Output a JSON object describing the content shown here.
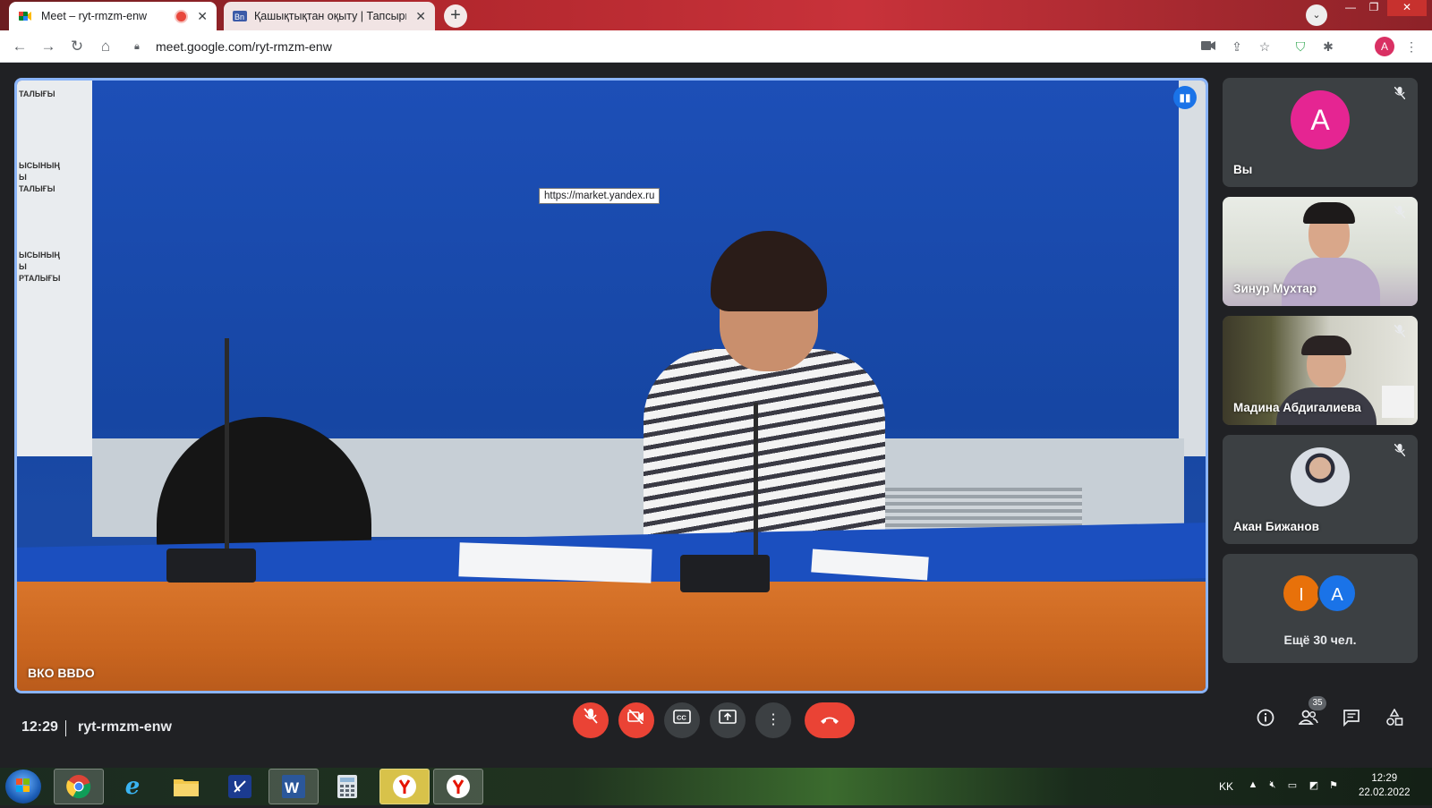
{
  "browser": {
    "tabs": [
      {
        "title": "Meet – ryt-rmzm-enw",
        "active": true,
        "recording": true,
        "favicon": "meet-favicon"
      },
      {
        "title": "Қашықтықтан оқыту | Тапсырма",
        "active": false,
        "favicon": "site-favicon"
      }
    ],
    "new_tab_label": "+",
    "url": "meet.google.com/ryt-rmzm-enw",
    "profile_initial": "A"
  },
  "meet": {
    "main_participant_name": "ВКО ВВDО",
    "hover_url": "https://market.yandex.ru",
    "banner_text": [
      "ТАЛЫҒЫ",
      "ЫСЫНЫҢ",
      "Ы",
      "ТАЛЫҒЫ",
      "ЫСЫНЫҢ",
      "Ы",
      "РТАЛЫҒЫ"
    ],
    "side_tiles": [
      {
        "name": "Вы",
        "avatar_initial": "A",
        "avatar_color": "#e52592",
        "muted": true
      },
      {
        "name": "Зинур Мухтар",
        "muted": true
      },
      {
        "name": "Мадина Абдигалиева",
        "muted": true
      },
      {
        "name": "Акан Бижанов",
        "muted": true
      }
    ],
    "more_people": {
      "label": "Ещё 30 чел.",
      "avatars": [
        {
          "initial": "I",
          "color": "#e8710a"
        },
        {
          "initial": "A",
          "color": "#1a73e8"
        }
      ]
    },
    "time": "12:29",
    "meeting_code": "ryt-rmzm-enw",
    "participant_count": "35",
    "accent_red": "#ea4335"
  },
  "taskbar": {
    "language": "KK",
    "clock_time": "12:29",
    "clock_date": "22.02.2022",
    "apps": [
      "chrome",
      "internet-explorer",
      "file-explorer",
      "phone-app",
      "word",
      "calculator",
      "yandex",
      "yandex"
    ]
  }
}
